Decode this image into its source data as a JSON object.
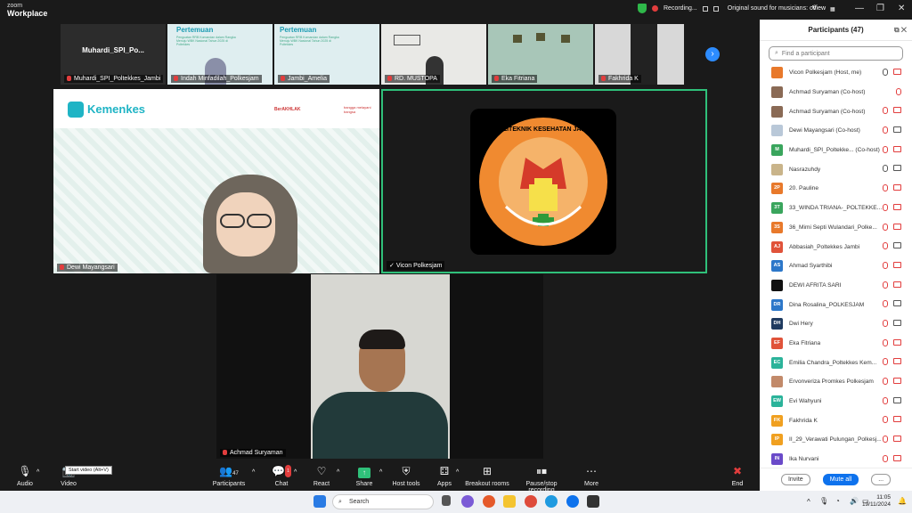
{
  "app": {
    "brand_small": "zoom",
    "brand_large": "Workplace"
  },
  "titlebar": {
    "recording": "Recording...",
    "original_sound": "Original sound for musicians: off",
    "view": "View"
  },
  "strip": [
    {
      "name": "Muhardi_SPI_Poltekkes_Jambi",
      "center_text": "Muhardi_SPI_Po..."
    },
    {
      "name": "Indah Minfadilah_Polkesjam"
    },
    {
      "name": "Jambi_Amelia"
    },
    {
      "name": "RD. MUSTOPA"
    },
    {
      "name": "Eka Fitriana"
    },
    {
      "name": "Fakhrida K"
    }
  ],
  "slide": {
    "heading": "Pertemuan",
    "sub": "Penguatan RRB Komandan dalam Rangka Menuju WBK Nasional Tahun 2025 di Poltekkes"
  },
  "main_tiles": {
    "left": {
      "name": "Dewi Mayangsari",
      "brand": "Kemenkes",
      "badge1": "BerAKHLAK",
      "badge2": "bangga melayani bangsa"
    },
    "right": {
      "name": "Vicon Polkesjam",
      "logo_text": "POLITEKNIK KESEHATAN JAMBI"
    },
    "bottom": {
      "name": "Achmad Suryaman"
    }
  },
  "toolbar": {
    "audio": "Audio",
    "video": "Video",
    "video_tooltip": "Start video (Alt+V)",
    "participants": "Participants",
    "participants_count": "47",
    "chat": "Chat",
    "chat_badge": "1",
    "react": "React",
    "share": "Share",
    "host_tools": "Host tools",
    "apps": "Apps",
    "breakout": "Breakout rooms",
    "pause_rec": "Pause/stop recording",
    "more": "More",
    "end": "End"
  },
  "panel": {
    "title": "Participants (47)",
    "search_placeholder": "Find a participant",
    "invite": "Invite",
    "mute_all": "Mute all",
    "more": "..."
  },
  "participants": [
    {
      "name": "Vicon Polkesjam (Host, me)",
      "initials": "",
      "color": "#e8792b",
      "mic": "on",
      "cam": "off"
    },
    {
      "name": "Achmad Suryaman (Co-host)",
      "initials": "",
      "color": "#8a6a55",
      "mic": "off",
      "cam": "none"
    },
    {
      "name": "Achmad Suryaman (Co-host)",
      "initials": "",
      "color": "#8a6a55",
      "mic": "off",
      "cam": "off"
    },
    {
      "name": "Dewi Mayangsari (Co-host)",
      "initials": "",
      "color": "#b9c8d8",
      "mic": "off",
      "cam": "on"
    },
    {
      "name": "Muhardi_SPI_Poltekke... (Co-host)",
      "initials": "M",
      "color": "#3aa55d",
      "mic": "off",
      "cam": "off"
    },
    {
      "name": "Nasrazuhdy",
      "initials": "",
      "color": "#c9b48a",
      "mic": "on",
      "cam": "on"
    },
    {
      "name": "20. Pauline",
      "initials": "2P",
      "color": "#e8792b",
      "mic": "off",
      "cam": "off"
    },
    {
      "name": "33_WINDA TRIANA-_POLTEKKE...",
      "initials": "3T",
      "color": "#3aa55d",
      "mic": "off",
      "cam": "off"
    },
    {
      "name": "36_Mimi Septi Wulandari_Polke...",
      "initials": "3S",
      "color": "#e8792b",
      "mic": "off",
      "cam": "off"
    },
    {
      "name": "Abbasiah_Poltekkes Jambi",
      "initials": "AJ",
      "color": "#e0533a",
      "mic": "off",
      "cam": "on"
    },
    {
      "name": "Ahmad Syarthibi",
      "initials": "AS",
      "color": "#2c77c9",
      "mic": "off",
      "cam": "off"
    },
    {
      "name": "DEWI AFRITA SARI",
      "initials": "",
      "color": "#111111",
      "mic": "off",
      "cam": "off"
    },
    {
      "name": "Dina Rosalina_POLKESJAM",
      "initials": "DR",
      "color": "#2c77c9",
      "mic": "off",
      "cam": "on"
    },
    {
      "name": "Dwi Hery",
      "initials": "DH",
      "color": "#1f3a5f",
      "mic": "off",
      "cam": "on"
    },
    {
      "name": "Eka Fitriana",
      "initials": "EF",
      "color": "#e0533a",
      "mic": "off",
      "cam": "off"
    },
    {
      "name": "Emilia Chandra_Poltekkes Kem...",
      "initials": "EC",
      "color": "#2bb39a",
      "mic": "off",
      "cam": "off"
    },
    {
      "name": "Ervonveriza Promkes Polkesjam",
      "initials": "",
      "color": "#c28a6a",
      "mic": "off",
      "cam": "off"
    },
    {
      "name": "Evi Wahyuni",
      "initials": "EW",
      "color": "#2bb39a",
      "mic": "off",
      "cam": "on"
    },
    {
      "name": "Fakhrida K",
      "initials": "FK",
      "color": "#f0a020",
      "mic": "off",
      "cam": "off"
    },
    {
      "name": "II_29_Verawati Pulungan_Polkesj...",
      "initials": "IP",
      "color": "#f0a020",
      "mic": "off",
      "cam": "off"
    },
    {
      "name": "Ika Nurvani",
      "initials": "IN",
      "color": "#6a4ac9",
      "mic": "off",
      "cam": "off"
    }
  ],
  "taskbar": {
    "search": "Search",
    "time": "11:05",
    "date": "19/11/2024"
  }
}
